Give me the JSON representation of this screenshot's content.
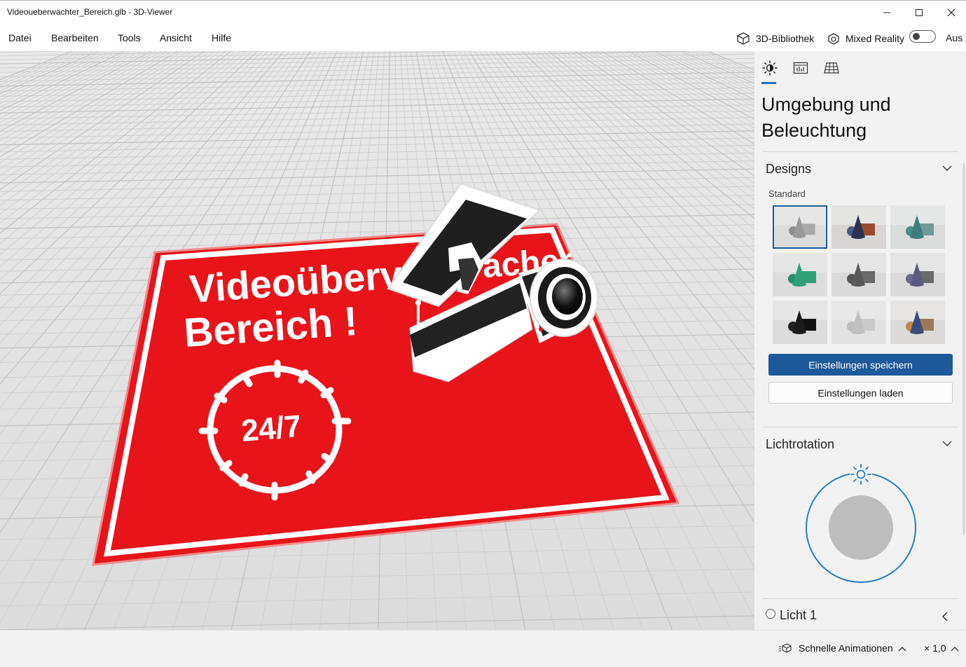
{
  "window": {
    "title": "Videoueberwachter_Bereich.glb - 3D-Viewer"
  },
  "menu": {
    "items": [
      "Datei",
      "Bearbeiten",
      "Tools",
      "Ansicht",
      "Hilfe"
    ]
  },
  "toolbar": {
    "library_label": "3D-Bibliothek",
    "mixed_reality_label": "Mixed Reality",
    "toggle_state_label": "Aus"
  },
  "panel": {
    "title": "Umgebung und Beleuchtung",
    "designs": {
      "title": "Designs",
      "subtitle": "Standard",
      "themes": [
        {
          "cone": "#9a9a9a",
          "box": "#a8a8a8",
          "sphere": "#8c8c8c",
          "bg": "#dcdcdc"
        },
        {
          "cone": "#2a3250",
          "box": "#9a4a32",
          "sphere": "#4c5a88",
          "bg": "#d8d6d4"
        },
        {
          "cone": "#3c7f7a",
          "box": "#6f9a94",
          "sphere": "#4a8c86",
          "bg": "#dadcdc"
        },
        {
          "cone": "#2fa078",
          "box": "#2fa078",
          "sphere": "#27906c",
          "bg": "#dcdcdc"
        },
        {
          "cone": "#5a5a5a",
          "box": "#6a6a6a",
          "sphere": "#555555",
          "bg": "#dadada"
        },
        {
          "cone": "#5a5a80",
          "box": "#6a6a6a",
          "sphere": "#6a6a88",
          "bg": "#dadada"
        },
        {
          "cone": "#1a1a1a",
          "box": "#111111",
          "sphere": "#222222",
          "bg": "#dcdcdc"
        },
        {
          "cone": "#c0c0c0",
          "box": "#cacaca",
          "sphere": "#bdbdbd",
          "bg": "#e2e2e2"
        },
        {
          "cone": "#3a4a7a",
          "box": "#9a7a5a",
          "sphere": "#c08a4a",
          "bg": "#dcdad8"
        }
      ],
      "selected_index": 0,
      "save_label": "Einstellungen speichern",
      "load_label": "Einstellungen laden"
    },
    "light_rotation": {
      "title": "Lichtrotation"
    },
    "light1": {
      "label": "Licht 1"
    }
  },
  "scene": {
    "sign_line1": "Videoüberv",
    "sign_line2": "Bereich !",
    "sign_clock": "24/7",
    "sign_fragment": "acher",
    "sign_color": "#e8141a"
  },
  "status": {
    "animation_label": "Schnelle Animationen",
    "speed_label": "× 1,0"
  },
  "colors": {
    "accent": "#1e5a9a",
    "ring": "#2b7cc4"
  }
}
